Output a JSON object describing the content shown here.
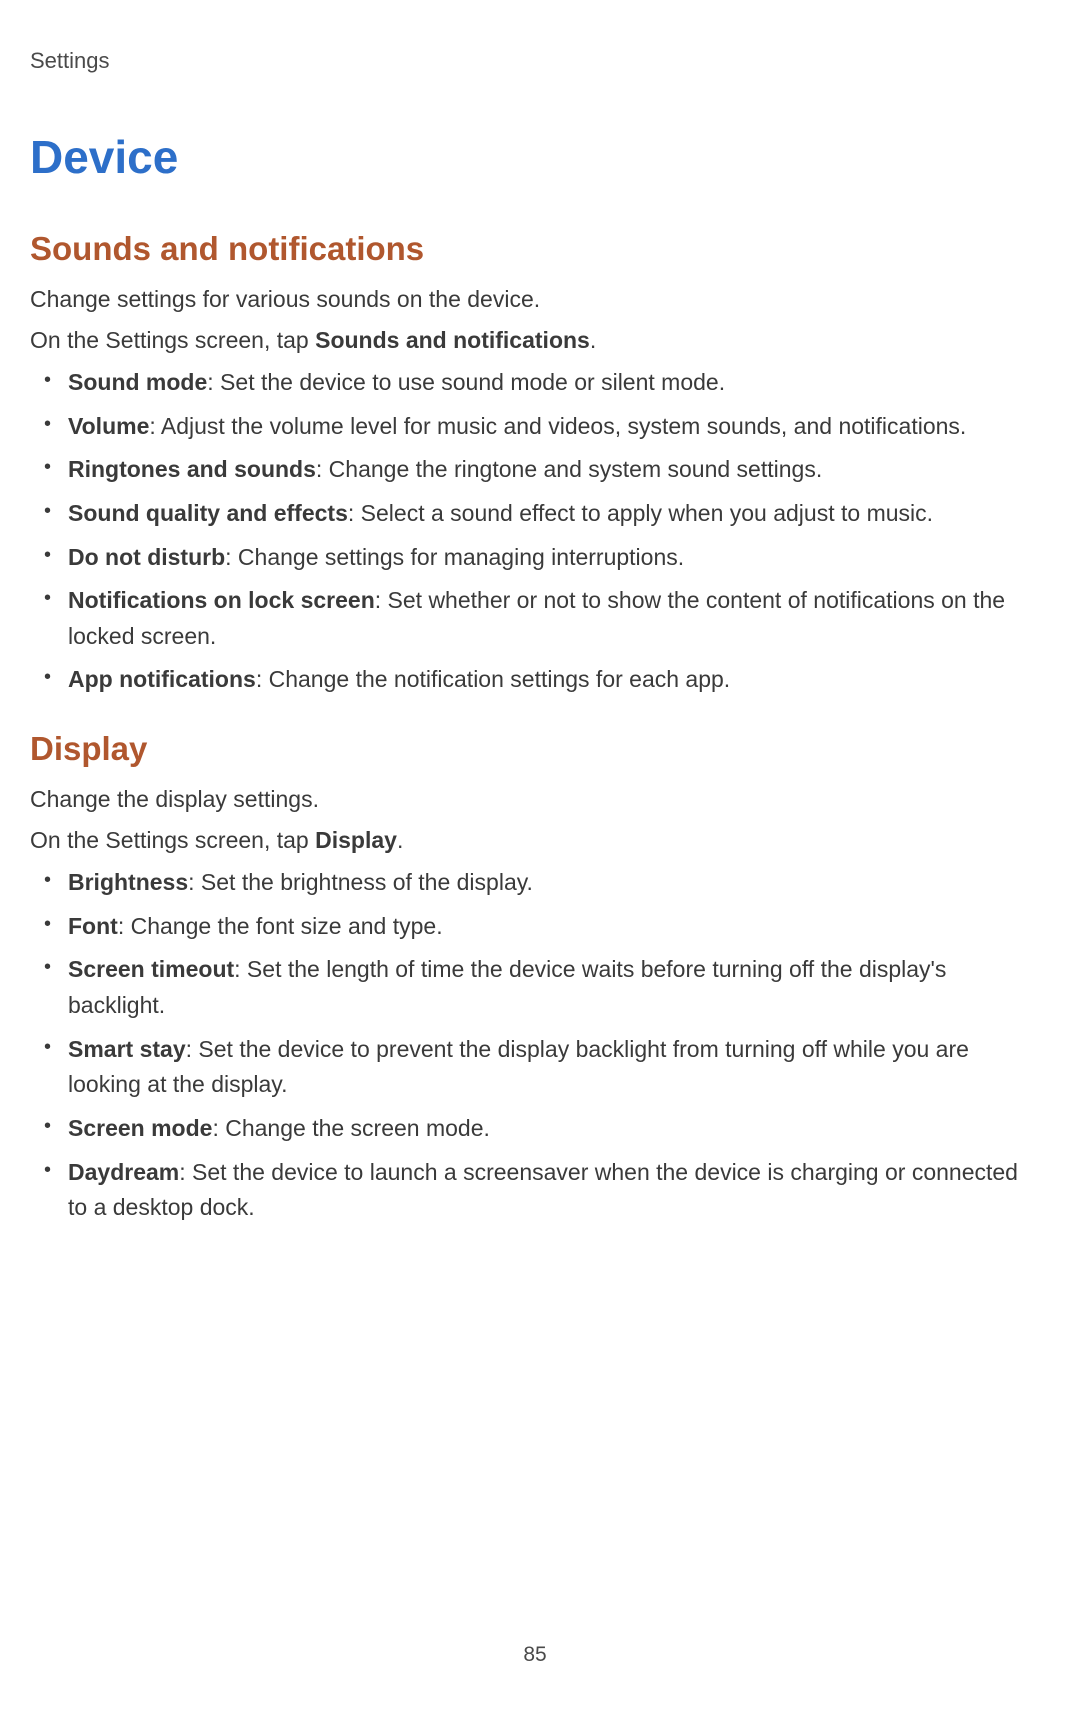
{
  "header": {
    "breadcrumb": "Settings"
  },
  "page_title": "Device",
  "sections": [
    {
      "title": "Sounds and notifications",
      "intro1": "Change settings for various sounds on the device.",
      "intro2_prefix": "On the Settings screen, tap ",
      "intro2_bold": "Sounds and notifications",
      "intro2_suffix": ".",
      "items": [
        {
          "label": "Sound mode",
          "desc": ": Set the device to use sound mode or silent mode."
        },
        {
          "label": "Volume",
          "desc": ": Adjust the volume level for music and videos, system sounds, and notifications."
        },
        {
          "label": "Ringtones and sounds",
          "desc": ": Change the ringtone and system sound settings."
        },
        {
          "label": "Sound quality and effects",
          "desc": ": Select a sound effect to apply when you adjust to music."
        },
        {
          "label": "Do not disturb",
          "desc": ": Change settings for managing interruptions."
        },
        {
          "label": "Notifications on lock screen",
          "desc": ": Set whether or not to show the content of notifications on the locked screen."
        },
        {
          "label": "App notifications",
          "desc": ": Change the notification settings for each app."
        }
      ]
    },
    {
      "title": "Display",
      "intro1": "Change the display settings.",
      "intro2_prefix": "On the Settings screen, tap ",
      "intro2_bold": "Display",
      "intro2_suffix": ".",
      "items": [
        {
          "label": "Brightness",
          "desc": ": Set the brightness of the display."
        },
        {
          "label": "Font",
          "desc": ": Change the font size and type."
        },
        {
          "label": "Screen timeout",
          "desc": ": Set the length of time the device waits before turning off the display's backlight."
        },
        {
          "label": "Smart stay",
          "desc": ": Set the device to prevent the display backlight from turning off while you are looking at the display."
        },
        {
          "label": "Screen mode",
          "desc": ": Change the screen mode."
        },
        {
          "label": "Daydream",
          "desc": ": Set the device to launch a screensaver when the device is charging or connected to a desktop dock."
        }
      ]
    }
  ],
  "page_number": "85"
}
